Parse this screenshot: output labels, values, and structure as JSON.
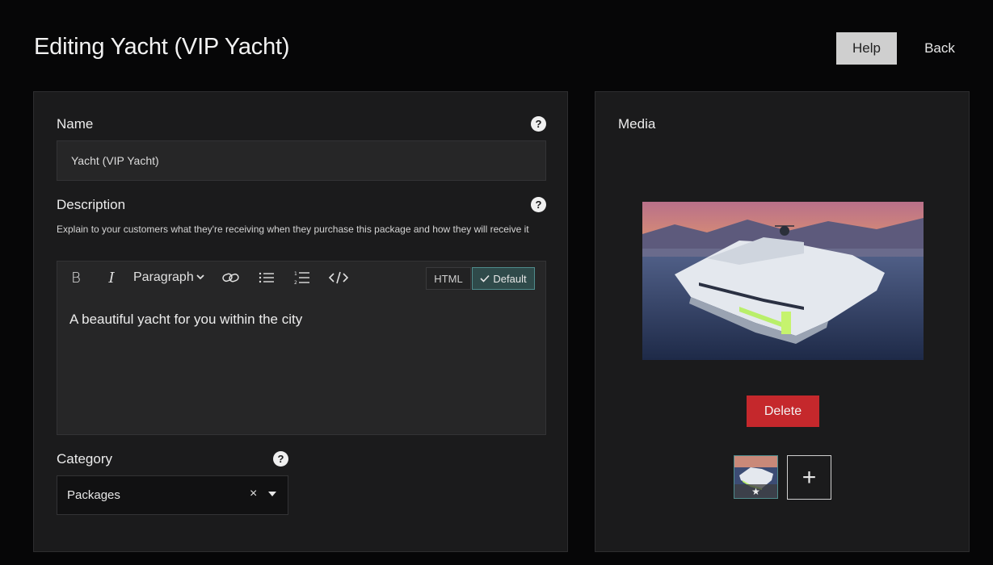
{
  "header": {
    "title": "Editing Yacht (VIP Yacht)",
    "help_label": "Help",
    "back_label": "Back"
  },
  "form": {
    "name": {
      "label": "Name",
      "value": "Yacht (VIP Yacht)",
      "help_icon": "question-circle-icon"
    },
    "description": {
      "label": "Description",
      "help_text": "Explain to your customers what they're receiving when they purchase this package and how they will receive it",
      "help_icon": "question-circle-icon",
      "toolbar": {
        "bold": "B",
        "italic": "I",
        "paragraph": "Paragraph",
        "html_mode": "HTML",
        "default_mode": "Default"
      },
      "content": "A beautiful yacht for you within the city"
    },
    "category": {
      "label": "Category",
      "value": "Packages",
      "clear_symbol": "×",
      "help_icon": "question-circle-icon"
    }
  },
  "media": {
    "label": "Media",
    "delete_label": "Delete",
    "add_symbol": "+",
    "thumbnail_badge": "★"
  },
  "colors": {
    "background": "#060607",
    "panel": "#1b1b1c",
    "input": "#262627",
    "accent_teal": "#4f8c8c",
    "delete_red": "#c5282c",
    "help_button": "#cfcfcf"
  }
}
